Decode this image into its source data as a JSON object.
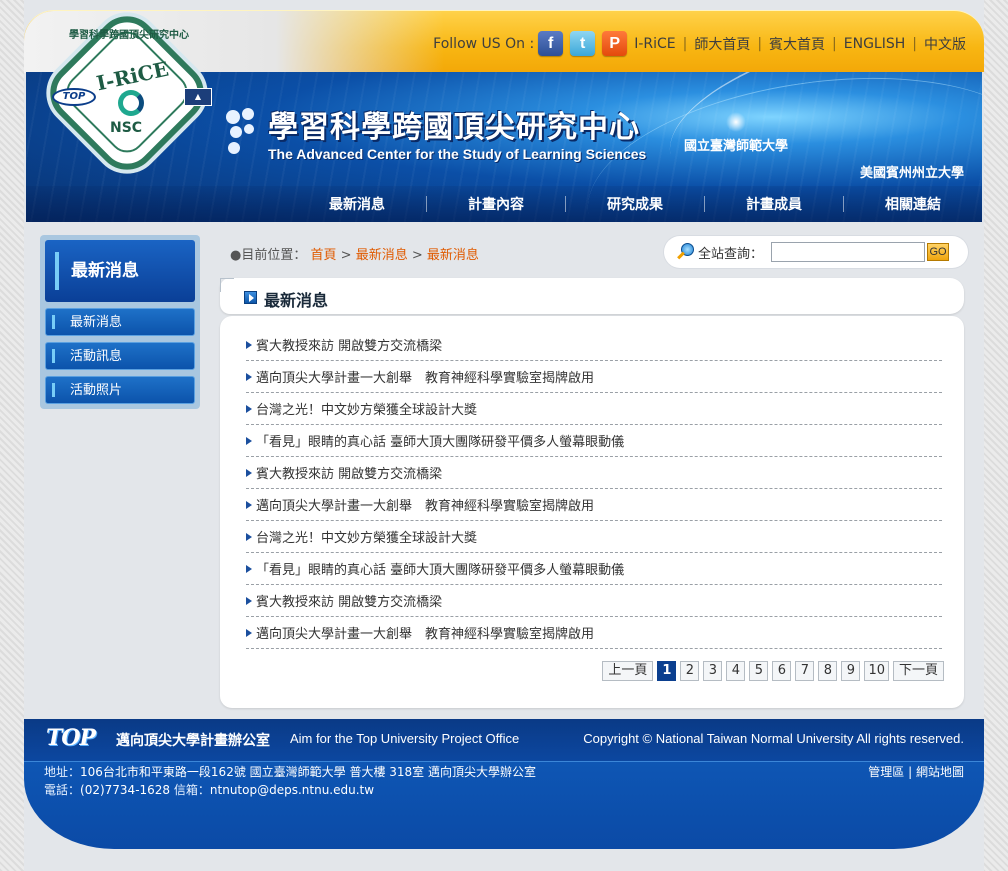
{
  "header": {
    "follow_label": "Follow US On :",
    "social": [
      {
        "name": "facebook",
        "glyph": "f"
      },
      {
        "name": "twitter",
        "glyph": "t"
      },
      {
        "name": "plurk",
        "glyph": "P"
      }
    ],
    "top_links": [
      "I-RiCE",
      "師大首頁",
      "賓大首頁",
      "ENGLISH",
      "中文版"
    ],
    "title_zh": "學習科學跨國頂尖研究中心",
    "title_en": "The Advanced Center for the Study of Learning Sciences",
    "univ_ntnu": "國立臺灣師範大學",
    "univ_psu": "美國賓州州立大學",
    "logo": {
      "arc_text": "學習科學跨國頂尖研究中心",
      "irice": "I-RiCE",
      "nsc": "NSC",
      "top": "TOP"
    }
  },
  "nav": [
    "最新消息",
    "計畫內容",
    "研究成果",
    "計畫成員",
    "相關連結"
  ],
  "sidebar": {
    "title": "最新消息",
    "items": [
      "最新消息",
      "活動訊息",
      "活動照片"
    ]
  },
  "breadcrumb": {
    "prefix": "●目前位置：",
    "home": "首頁",
    "sep": ">",
    "level1": "最新消息",
    "level2": "最新消息"
  },
  "search": {
    "label": "全站查詢：",
    "placeholder": "",
    "go": "GO"
  },
  "main": {
    "section_title": "最新消息",
    "news": [
      "賓大教授來訪 開啟雙方交流橋梁",
      "邁向頂尖大學計畫一大創舉　教育神經科學實驗室揭牌啟用",
      "台灣之光！中文妙方榮獲全球設計大獎",
      "「看見」眼睛的真心話 臺師大頂大團隊研發平價多人螢幕眼動儀",
      "賓大教授來訪 開啟雙方交流橋梁",
      "邁向頂尖大學計畫一大創舉　教育神經科學實驗室揭牌啟用",
      "台灣之光！中文妙方榮獲全球設計大獎",
      "「看見」眼睛的真心話 臺師大頂大團隊研發平價多人螢幕眼動儀",
      "賓大教授來訪 開啟雙方交流橋梁",
      "邁向頂尖大學計畫一大創舉　教育神經科學實驗室揭牌啟用"
    ],
    "pager": {
      "prev": "上一頁",
      "next": "下一頁",
      "pages": [
        "1",
        "2",
        "3",
        "4",
        "5",
        "6",
        "7",
        "8",
        "9",
        "10"
      ],
      "current": "1"
    }
  },
  "footer": {
    "top_logo": "TOP",
    "office_zh": "邁向頂尖大學計畫辦公室",
    "office_en": "Aim for the Top University Project Office",
    "copyright": "Copyright © National Taiwan Normal University All rights reserved.",
    "address_label": "地址：",
    "address": "106台北市和平東路一段162號 國立臺灣師範大學 普大樓 318室 邁向頂尖大學辦公室",
    "phone_label": "電話：",
    "phone": "(02)7734-1628",
    "email_label": "信箱：",
    "email": "ntnutop@deps.ntnu.edu.tw",
    "admin": "管理區",
    "sitemap": "網站地圖"
  },
  "colors": {
    "brand_blue": "#0b4aa6",
    "accent_orange": "#f8b612",
    "breadcrumb_link": "#e05a00"
  }
}
